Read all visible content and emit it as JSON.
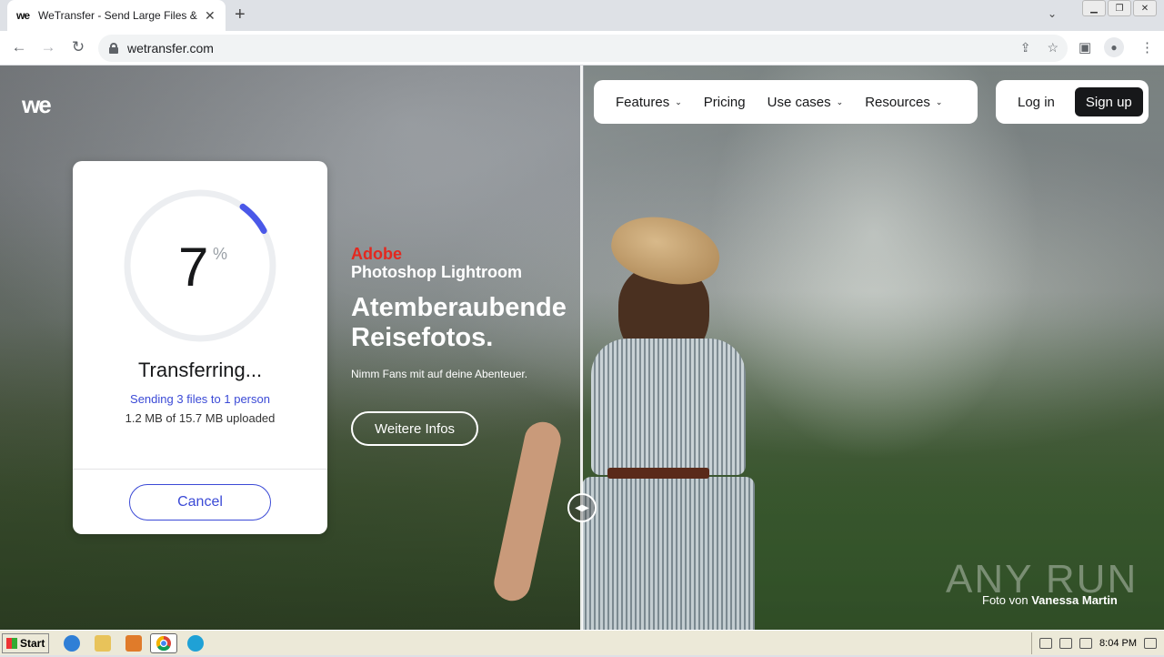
{
  "browser": {
    "tab_title": "WeTransfer - Send Large Files & Sha",
    "tab_favicon": "we",
    "url": "wetransfer.com"
  },
  "page": {
    "logo": "we",
    "nav": {
      "features": "Features",
      "pricing": "Pricing",
      "use_cases": "Use cases",
      "resources": "Resources",
      "login": "Log in",
      "signup": "Sign up"
    },
    "transfer": {
      "percent": "7",
      "percent_sign": "%",
      "progress_fraction": 0.07,
      "status": "Transferring...",
      "sending": "Sending 3 files to 1 person",
      "uploaded": "1.2 MB of 15.7 MB uploaded",
      "cancel": "Cancel",
      "accent": "#3b4ad6"
    },
    "ad": {
      "brand": "Adobe",
      "product": "Photoshop Lightroom",
      "headline": "Atemberaubende Reisefotos.",
      "subline": "Nimm Fans mit auf deine Abenteuer.",
      "button": "Weitere Infos"
    },
    "credit_prefix": "Foto von",
    "credit_name": "Vanessa Martin",
    "watermark": "ANY RUN"
  },
  "taskbar": {
    "start": "Start",
    "clock": "8:04 PM"
  }
}
